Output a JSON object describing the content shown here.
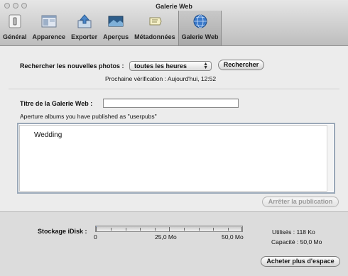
{
  "window": {
    "title": "Galerie Web"
  },
  "toolbar": {
    "items": [
      {
        "label": "Général",
        "icon": "switch-icon"
      },
      {
        "label": "Apparence",
        "icon": "window-icon"
      },
      {
        "label": "Exporter",
        "icon": "export-icon"
      },
      {
        "label": "Aperçus",
        "icon": "preview-icon"
      },
      {
        "label": "Métadonnées",
        "icon": "tag-icon"
      },
      {
        "label": "Galerie Web",
        "icon": "globe-icon",
        "active": true
      }
    ]
  },
  "check": {
    "label": "Rechercher les nouvelles photos :",
    "frequency": "toutes les heures",
    "search_button": "Rechercher",
    "next_check": "Prochaine vérification : Aujourd'hui, 12:52"
  },
  "gallery": {
    "title_label": "Titre de la Galerie Web :",
    "title_value": "",
    "albums_caption": "Aperture albums you have published as \"userpubs\"",
    "albums": [
      "Wedding"
    ],
    "stop_button": "Arrêter la publication"
  },
  "storage": {
    "label": "Stockage iDisk :",
    "used_fraction": 0.0023,
    "scale": [
      "0",
      "25,0 Mo",
      "50,0 Mo"
    ],
    "used": "Utilisés :  118 Ko",
    "capacity": "Capacité :  50,0 Mo",
    "buy_button": "Acheter plus d'espace"
  }
}
